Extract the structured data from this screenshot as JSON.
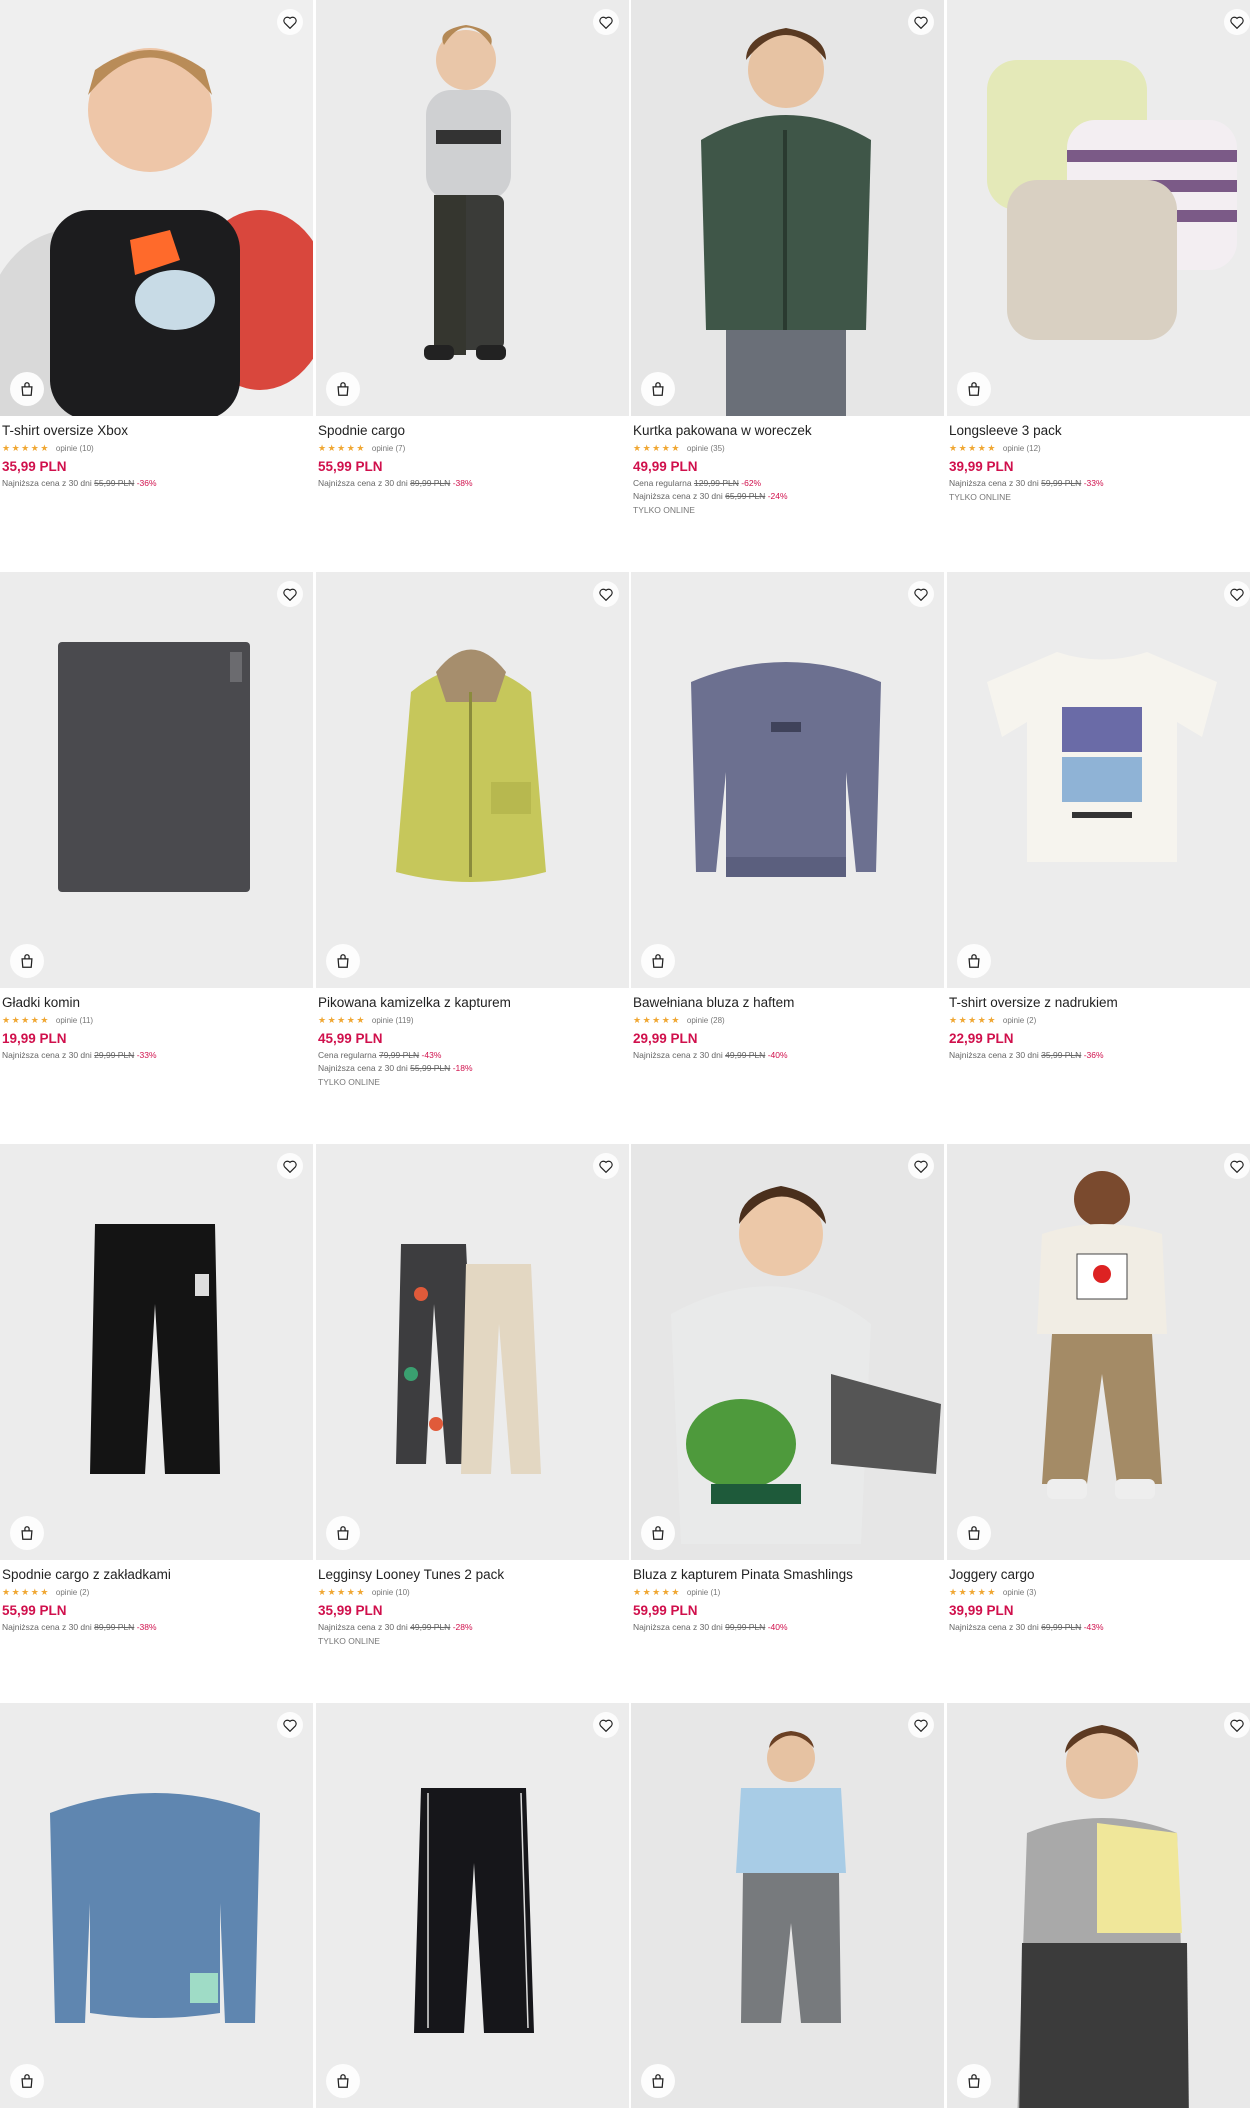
{
  "products": [
    {
      "name": "T-shirt oversize Xbox",
      "rating": 5,
      "reviews": "opinie (10)",
      "price": "35,99 PLN",
      "lines": [
        {
          "label": "Najniższa cena z 30 dni",
          "old": "55,99 PLN",
          "disc": "-36%"
        }
      ],
      "tag": "",
      "bg": "#efefef"
    },
    {
      "name": "Spodnie cargo",
      "rating": 4.5,
      "reviews": "opinie (7)",
      "price": "55,99 PLN",
      "lines": [
        {
          "label": "Najniższa cena z 30 dni",
          "old": "89,99 PLN",
          "disc": "-38%"
        }
      ],
      "tag": "",
      "bg": "#ebebeb"
    },
    {
      "name": "Kurtka pakowana w woreczek",
      "rating": 4.5,
      "reviews": "opinie (35)",
      "price": "49,99 PLN",
      "lines": [
        {
          "label": "Cena regularna",
          "old": "129,99 PLN",
          "disc": "-62%"
        },
        {
          "label": "Najniższa cena z 30 dni",
          "old": "65,99 PLN",
          "disc": "-24%"
        }
      ],
      "tag": "TYLKO ONLINE",
      "bg": "#e6e6e6"
    },
    {
      "name": "Longsleeve 3 pack",
      "rating": 5,
      "reviews": "opinie (12)",
      "price": "39,99 PLN",
      "lines": [
        {
          "label": "Najniższa cena z 30 dni",
          "old": "59,99 PLN",
          "disc": "-33%"
        }
      ],
      "tag": "TYLKO ONLINE",
      "bg": "#ececec"
    },
    {
      "name": "Gładki komin",
      "rating": 4.5,
      "reviews": "opinie (11)",
      "price": "19,99 PLN",
      "lines": [
        {
          "label": "Najniższa cena z 30 dni",
          "old": "29,99 PLN",
          "disc": "-33%"
        }
      ],
      "tag": "",
      "bg": "#ececec"
    },
    {
      "name": "Pikowana kamizelka z kapturem",
      "rating": 5,
      "reviews": "opinie (119)",
      "price": "45,99 PLN",
      "lines": [
        {
          "label": "Cena regularna",
          "old": "79,99 PLN",
          "disc": "-43%"
        },
        {
          "label": "Najniższa cena z 30 dni",
          "old": "55,99 PLN",
          "disc": "-18%"
        }
      ],
      "tag": "TYLKO ONLINE",
      "bg": "#ececec"
    },
    {
      "name": "Bawełniana bluza z haftem",
      "rating": 5,
      "reviews": "opinie (28)",
      "price": "29,99 PLN",
      "lines": [
        {
          "label": "Najniższa cena z 30 dni",
          "old": "49,99 PLN",
          "disc": "-40%"
        }
      ],
      "tag": "",
      "bg": "#ececec"
    },
    {
      "name": "T-shirt oversize z nadrukiem",
      "rating": 5,
      "reviews": "opinie (2)",
      "price": "22,99 PLN",
      "lines": [
        {
          "label": "Najniższa cena z 30 dni",
          "old": "35,99 PLN",
          "disc": "-36%"
        }
      ],
      "tag": "",
      "bg": "#ececec"
    },
    {
      "name": "Spodnie cargo z zakładkami",
      "rating": 5,
      "reviews": "opinie (2)",
      "price": "55,99 PLN",
      "lines": [
        {
          "label": "Najniższa cena z 30 dni",
          "old": "89,99 PLN",
          "disc": "-38%"
        }
      ],
      "tag": "",
      "bg": "#ececec"
    },
    {
      "name": "Legginsy Looney Tunes 2 pack",
      "rating": 5,
      "reviews": "opinie (10)",
      "price": "35,99 PLN",
      "lines": [
        {
          "label": "Najniższa cena z 30 dni",
          "old": "49,99 PLN",
          "disc": "-28%"
        }
      ],
      "tag": "TYLKO ONLINE",
      "bg": "#ececec"
    },
    {
      "name": "Bluza z kapturem Pinata Smashlings",
      "rating": 5,
      "reviews": "opinie (1)",
      "price": "59,99 PLN",
      "lines": [
        {
          "label": "Najniższa cena z 30 dni",
          "old": "99,99 PLN",
          "disc": "-40%"
        }
      ],
      "tag": "",
      "bg": "#e6e6e6"
    },
    {
      "name": "Joggery cargo",
      "rating": 5,
      "reviews": "opinie (3)",
      "price": "39,99 PLN",
      "lines": [
        {
          "label": "Najniższa cena z 30 dni",
          "old": "69,99 PLN",
          "disc": "-43%"
        }
      ],
      "tag": "",
      "bg": "#e9e9e9"
    },
    {
      "name": "",
      "rating": 0,
      "reviews": "",
      "price": "",
      "lines": [],
      "tag": "",
      "bg": "#ececec"
    },
    {
      "name": "",
      "rating": 0,
      "reviews": "",
      "price": "",
      "lines": [],
      "tag": "",
      "bg": "#ececec"
    },
    {
      "name": "",
      "rating": 0,
      "reviews": "",
      "price": "",
      "lines": [],
      "tag": "",
      "bg": "#e7e7e7"
    },
    {
      "name": "",
      "rating": 0,
      "reviews": "",
      "price": "",
      "lines": [],
      "tag": "",
      "bg": "#e9e9e9"
    }
  ],
  "icons": {
    "favorite": "heart-icon",
    "add_to_cart": "shopping-bag-icon"
  },
  "colors": {
    "price": "#d0104c",
    "star": "#f0a733"
  }
}
